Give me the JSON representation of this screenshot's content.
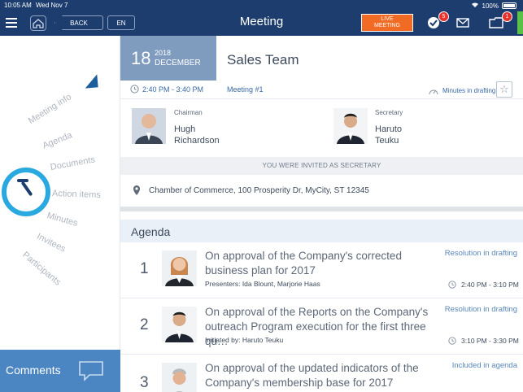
{
  "status_bar": {
    "time": "10:05 AM",
    "date": "Wed Nov 7",
    "battery": "100%"
  },
  "nav": {
    "back_label": "BACK",
    "lang_label": "EN",
    "title": "Meeting",
    "live_label_line1": "LIVE",
    "live_label_line2": "MEETING",
    "tasks_badge": "5",
    "folder_badge": "1",
    "accent_color": "#1c3d6e",
    "live_color": "#f26b24"
  },
  "sidebar": {
    "wheel_items": [
      "Meeting info",
      "Agenda",
      "Documents",
      "Action items",
      "Minutes",
      "Invitees",
      "Participants"
    ],
    "comments_label": "Comments"
  },
  "meeting": {
    "day": "18",
    "year": "2018",
    "month": "DECEMBER",
    "name": "Sales Team",
    "time": "2:40 PM - 3:40 PM",
    "number": "Meeting #1",
    "status": "Minutes in drafting"
  },
  "people": {
    "chairman_role": "Chairman",
    "chairman_first": "Hugh",
    "chairman_last": "Richardson",
    "secretary_role": "Secretary",
    "secretary_first": "Haruto",
    "secretary_last": "Teuku"
  },
  "invite_text": "YOU WERE INVITED AS SECRETARY",
  "address": "Chamber of Commerce, 100 Prosperity Dr, MyCity, ST 12345",
  "agenda": {
    "heading": "Agenda",
    "items": [
      {
        "num": "1",
        "title": "On approval of the Company's corrected business plan for 2017",
        "sub": "Presenters: Ida Blount, Marjorie Haas",
        "state": "Resolution in drafting",
        "time": "2:40 PM - 3:10 PM"
      },
      {
        "num": "2",
        "title": "On approval of the Reports on the Company's outreach Program execution for the first three qu…",
        "sub": "Initiated by: Haruto Teuku",
        "state": "Resolution in drafting",
        "time": "3:10 PM - 3:30 PM"
      },
      {
        "num": "3",
        "title": "On approval of the updated indicators of the Company's membership base for 2017",
        "sub": "",
        "state": "Included in agenda",
        "time": ""
      }
    ]
  }
}
